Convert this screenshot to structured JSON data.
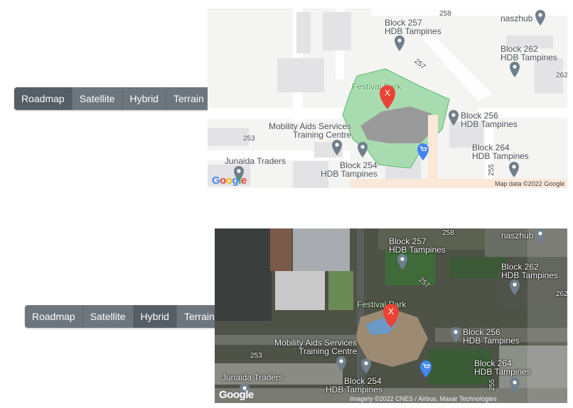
{
  "map_type_buttons": [
    "Roadmap",
    "Satellite",
    "Hybrid",
    "Terrain"
  ],
  "panels": [
    {
      "selected": "Roadmap"
    },
    {
      "selected": "Hybrid"
    }
  ],
  "map": {
    "labels": {
      "block257_a": "Block 257",
      "block257_b": "HDB Tampines",
      "block262_a": "Block 262",
      "block262_b": "HDB Tampines",
      "naszhub": "naszhub",
      "road258": "258",
      "road257": "257",
      "road253": "253",
      "road255": "255",
      "road262": "262",
      "festival_park": "Festival Park",
      "block256_a": "Block 256",
      "block256_b": "HDB Tampines",
      "mobility_a": "Mobility Aids Services",
      "mobility_b": "Training Centre",
      "block264_a": "Block 264",
      "block264_b": "HDB Tampines",
      "block254_a": "Block 254",
      "block254_b": "HDB Tampines",
      "junaida": "Junaida Traders"
    },
    "marker_label": "X",
    "google_logo": [
      "G",
      "o",
      "o",
      "g",
      "l",
      "e"
    ],
    "attribution": "Map data ©2022 Google",
    "attribution_satellite": "Imagery ©2022 CNES / Airbus, Maxar Technologies"
  },
  "colors": {
    "button_bg": "#6d757d",
    "button_active": "#555d65",
    "park_green": "#a8dcb0",
    "marker_red": "#ea4335",
    "pin_gray": "#6f7f8c",
    "shop_blue": "#4285f4"
  },
  "icons": [
    "map-pin-icon",
    "shopping-cart-icon",
    "red-marker-icon"
  ]
}
